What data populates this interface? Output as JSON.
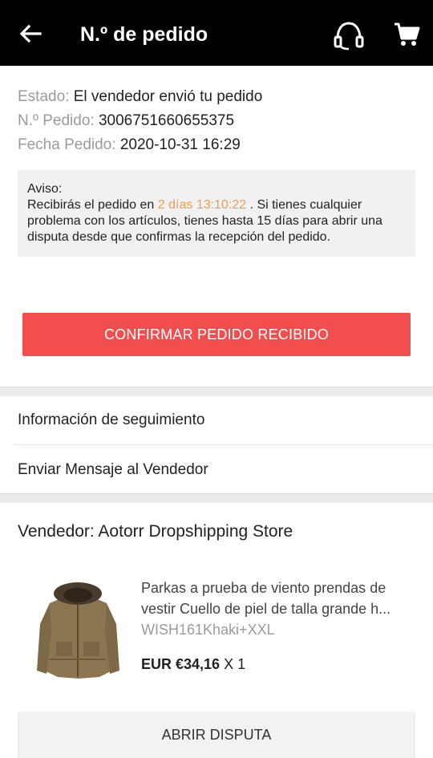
{
  "header": {
    "title": "N.º de pedido",
    "back_icon": "arrow-left-icon",
    "support_icon": "headset-icon",
    "cart_icon": "shopping-cart-icon"
  },
  "order": {
    "status_label": "Estado:",
    "status_value": "El vendedor envió tu pedido",
    "number_label": "N.º Pedido:",
    "number_value": "3006751660655375",
    "date_label": "Fecha Pedido:",
    "date_value": "2020-10-31 16:29"
  },
  "notice": {
    "title": "Aviso:",
    "text_before": "Recibirás el pedido en",
    "countdown": "2 días 13:10:22",
    "text_after": ". Si tienes cualquier problema con los artículos, tienes hasta 15 días para abrir una disputa desde que confirmas la recepción del pedido.",
    "highlight_color": "#f39c4a"
  },
  "confirm_button": {
    "label": "CONFIRMAR PEDIDO RECIBIDO",
    "color": "#f24e4e"
  },
  "links": {
    "tracking": "Información de seguimiento",
    "message_seller": "Enviar Mensaje al Vendedor"
  },
  "seller": {
    "label": "Vendedor: Aotorr Dropshipping Store"
  },
  "product": {
    "title_line1": "Parkas a prueba de viento prendas de",
    "title_line2": "vestir Cuello de piel de talla grande h...",
    "sku": "WISH161Khaki+XXL",
    "price": "EUR €34,16",
    "quantity": "X 1",
    "image_icon": "parka-jacket-image"
  },
  "dispute_button": {
    "label": "ABRIR DISPUTA"
  }
}
